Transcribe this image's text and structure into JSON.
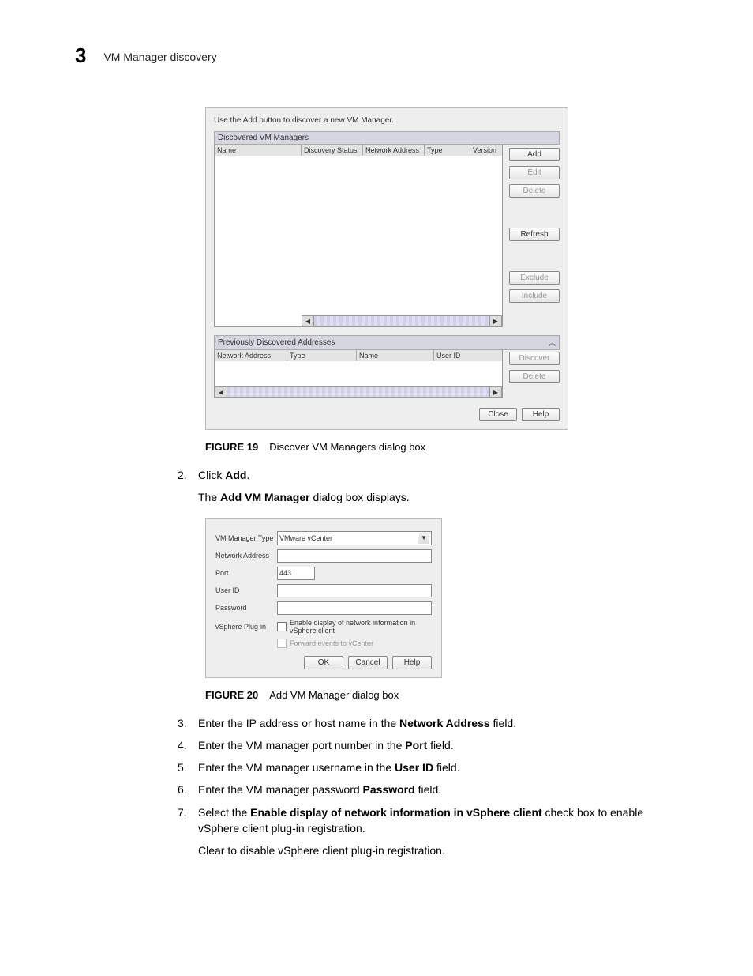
{
  "header": {
    "chapter_number": "3",
    "chapter_title": "VM Manager discovery"
  },
  "dialog1": {
    "hint": "Use the Add button to discover a new VM Manager.",
    "section1_title": "Discovered VM Managers",
    "cols": {
      "name": "Name",
      "status": "Discovery Status",
      "addr": "Network Address",
      "type": "Type",
      "version": "Version"
    },
    "buttons": {
      "add": "Add",
      "edit": "Edit",
      "delete": "Delete",
      "refresh": "Refresh",
      "exclude": "Exclude",
      "include": "Include"
    },
    "section2_title": "Previously Discovered Addresses",
    "cols2": {
      "addr": "Network Address",
      "type": "Type",
      "name": "Name",
      "user": "User ID"
    },
    "buttons2": {
      "discover": "Discover",
      "delete": "Delete"
    },
    "footer": {
      "close": "Close",
      "help": "Help"
    }
  },
  "fig19": {
    "label": "FIGURE 19",
    "caption": "Discover VM Managers dialog box"
  },
  "step2": {
    "num": "2.",
    "text_a": "Click ",
    "bold": "Add",
    "text_b": ".",
    "sub_a": "The ",
    "sub_bold": "Add VM Manager",
    "sub_b": " dialog box displays."
  },
  "dialog2": {
    "labels": {
      "type": "VM Manager Type",
      "addr": "Network Address",
      "port": "Port",
      "user": "User ID",
      "pass": "Password",
      "plugin": "vSphere Plug-in"
    },
    "type_value": "VMware vCenter",
    "port_value": "443",
    "check1": "Enable display of network information in vSphere client",
    "check2": "Forward events to vCenter",
    "footer": {
      "ok": "OK",
      "cancel": "Cancel",
      "help": "Help"
    }
  },
  "fig20": {
    "label": "FIGURE 20",
    "caption": "Add VM Manager dialog box"
  },
  "steps": {
    "s3": {
      "num": "3.",
      "a": "Enter the IP address or host name in the ",
      "b": "Network Address",
      "c": " field."
    },
    "s4": {
      "num": "4.",
      "a": "Enter the VM manager port number in the ",
      "b": "Port",
      "c": " field."
    },
    "s5": {
      "num": "5.",
      "a": "Enter the VM manager username in the ",
      "b": "User ID",
      "c": " field."
    },
    "s6": {
      "num": "6.",
      "a": "Enter the VM manager password ",
      "b": "Password",
      "c": " field."
    },
    "s7": {
      "num": "7.",
      "a": "Select the ",
      "b": "Enable display of network information in vSphere client",
      "c": " check box to enable vSphere client plug-in registration."
    },
    "s7sub": "Clear to disable vSphere client plug-in registration."
  }
}
